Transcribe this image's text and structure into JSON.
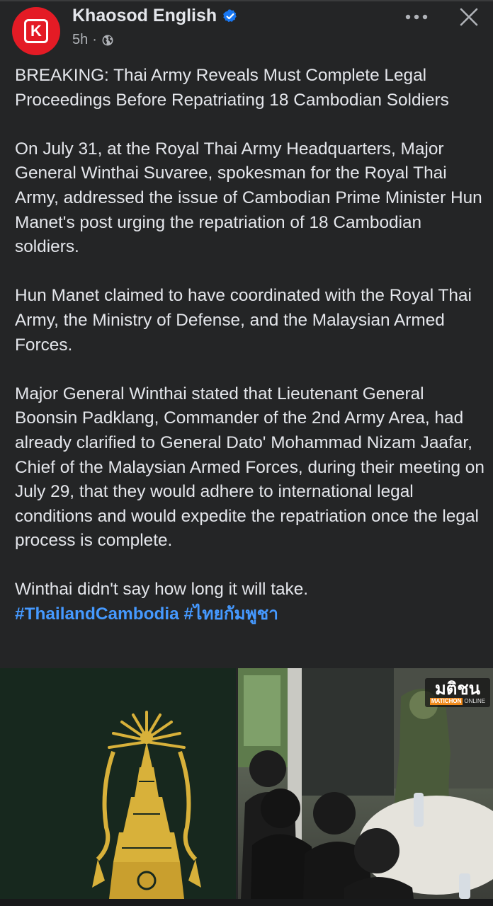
{
  "post": {
    "page_name": "Khaosod English",
    "avatar_letter": "K",
    "time": "5h",
    "separator": "·",
    "paragraphs": [
      "BREAKING: Thai Army Reveals Must Complete Legal Proceedings Before Repatriating 18 Cambodian Soldiers",
      "On July 31, at the Royal Thai Army Headquarters, Major General Winthai Suvaree, spokesman for the Royal Thai Army, addressed the issue of Cambodian Prime Minister Hun Manet's post urging the repatriation of 18 Cambodian soldiers.",
      "Hun Manet claimed to have coordinated with the Royal Thai Army, the Ministry of Defense, and the Malaysian Armed Forces.",
      "Major General Winthai stated that Lieutenant General Boonsin Padklang, Commander of the 2nd Army Area, had already clarified to General Dato' Mohammad Nizam Jaafar, Chief of the Malaysian Armed Forces, during their meeting on July 29, that they would adhere to international legal conditions and would expedite the repatriation once the legal process is complete.",
      "Winthai didn't say how long it will take."
    ],
    "hashtags": [
      "#ThailandCambodia",
      "#ไทยกัมพูชา"
    ]
  },
  "media": {
    "watermark_main": "มติชน",
    "watermark_brand": "MATICHON",
    "watermark_online": "ONLINE"
  },
  "colors": {
    "background": "#242526",
    "text": "#e4e6eb",
    "secondary_text": "#b0b3b8",
    "link": "#4599ff",
    "avatar": "#e41b25",
    "verified": "#1877f2",
    "emblem_bg": "#17281e",
    "emblem_gold": "#d8b13a"
  },
  "icons": {
    "verified": "verified-badge-icon",
    "audience": "globe-icon",
    "more": "more-options-icon",
    "close": "close-icon"
  }
}
